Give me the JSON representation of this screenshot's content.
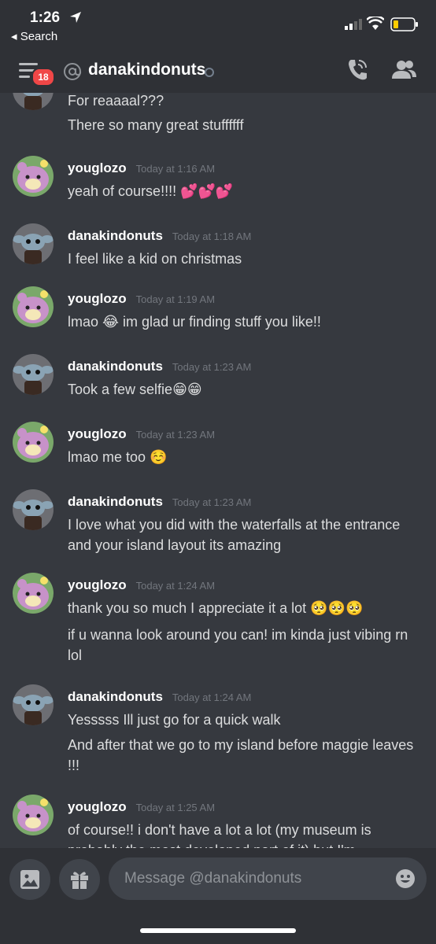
{
  "status_bar": {
    "time": "1:26",
    "back_label": "◂ Search"
  },
  "header": {
    "channel_name": "danakindonuts",
    "unread_badge": "18"
  },
  "messages": [
    {
      "lines": [
        "For reaaaal???",
        "There so many great stuffffff"
      ]
    },
    {
      "author": "youglozo",
      "time": "Today at 1:16 AM",
      "lines": [
        "yeah of course!!!! 💕💕💕"
      ]
    },
    {
      "author": "danakindonuts",
      "time": "Today at 1:18 AM",
      "lines": [
        "I feel like a kid on christmas"
      ]
    },
    {
      "author": "youglozo",
      "time": "Today at 1:19 AM",
      "lines": [
        "lmao 😂 im glad ur finding stuff you like!!"
      ]
    },
    {
      "author": "danakindonuts",
      "time": "Today at 1:23 AM",
      "lines": [
        "Took a few selfie😁😁"
      ]
    },
    {
      "author": "youglozo",
      "time": "Today at 1:23 AM",
      "lines": [
        "lmao me too ☺️"
      ]
    },
    {
      "author": "danakindonuts",
      "time": "Today at 1:23 AM",
      "lines": [
        "I love what you did with the waterfalls at the entrance and your island layout its amazing"
      ]
    },
    {
      "author": "youglozo",
      "time": "Today at 1:24 AM",
      "lines": [
        "thank you so much I appreciate it a lot 🥺🥺🥺",
        "if u wanna look around you can! im kinda just vibing rn lol"
      ]
    },
    {
      "author": "danakindonuts",
      "time": "Today at 1:24 AM",
      "lines": [
        "Yesssss Ill just go for a quick walk",
        "And after that we go to my island before maggie leaves !!!"
      ]
    },
    {
      "author": "youglozo",
      "time": "Today at 1:25 AM",
      "lines": [
        "of course!! i don't have a lot a lot (my museum is probably the most developed part of it) but I'm"
      ]
    }
  ],
  "composer": {
    "placeholder": "Message @danakindonuts"
  },
  "colors": {
    "background": "#36393f",
    "header": "#2f3136",
    "badge": "#f04747",
    "timestamp": "#72767d"
  }
}
